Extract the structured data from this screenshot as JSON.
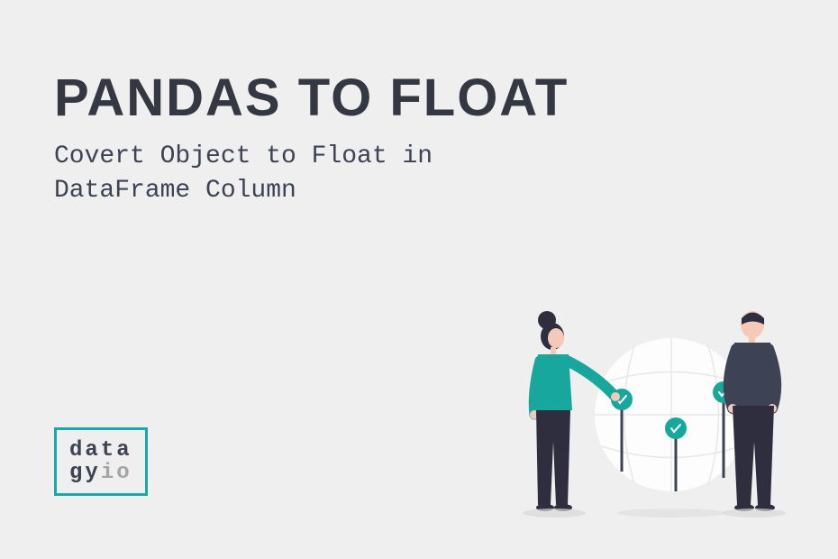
{
  "title": "PANDAS TO FLOAT",
  "subtitle_line1": "Covert Object to Float in",
  "subtitle_line2": "DataFrame Column",
  "logo": {
    "line1": "data",
    "line2_part1": "gy",
    "line2_part2": "io"
  },
  "colors": {
    "background": "#efefef",
    "text_dark": "#343842",
    "text_body": "#3d4254",
    "accent": "#1aa8a8",
    "muted": "#a5a5a5",
    "skin": "#f4c9b8",
    "shirt_teal": "#18a79d",
    "pants_dark": "#2f2e3f"
  }
}
